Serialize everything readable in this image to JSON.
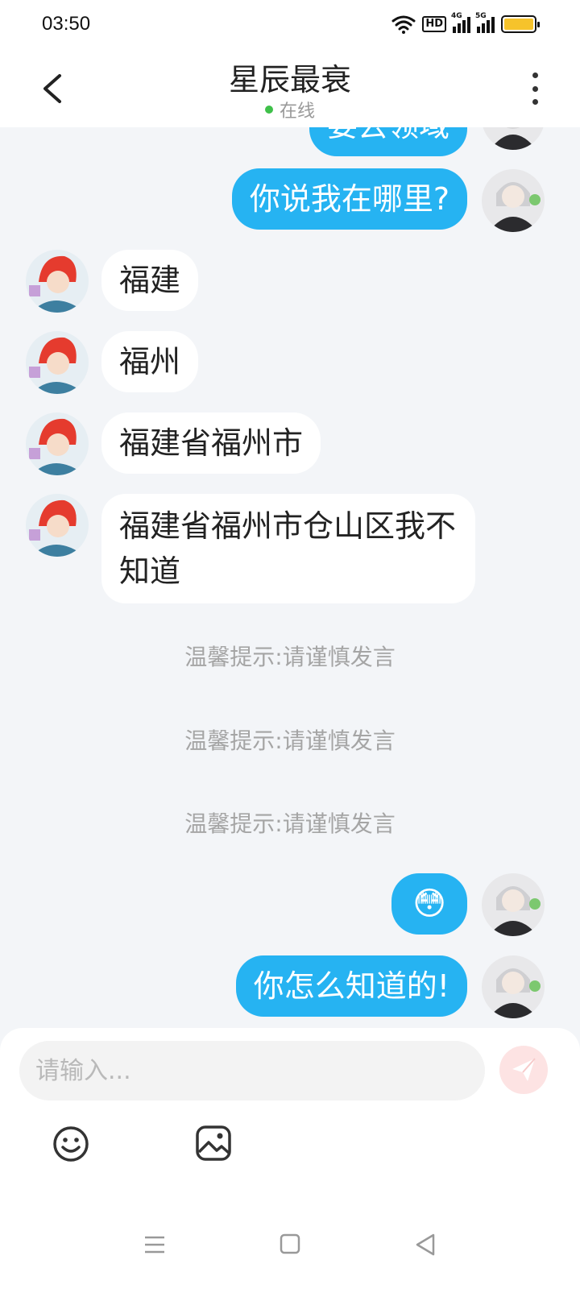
{
  "status_bar": {
    "time": "03:50",
    "signal_1_label": "4G",
    "signal_2_label": "5G",
    "hd_label": "HD",
    "battery_color": "#f6c32b"
  },
  "header": {
    "title": "星辰最衰",
    "status": "在线"
  },
  "messages": [
    {
      "side": "out",
      "text": "要去领域"
    },
    {
      "side": "out",
      "text": "你说我在哪里?"
    },
    {
      "side": "in",
      "text": "福建"
    },
    {
      "side": "in",
      "text": "福州"
    },
    {
      "side": "in",
      "text": "福建省福州市"
    },
    {
      "side": "in",
      "text": "福建省福州市仓山区我不知道"
    },
    {
      "side": "system",
      "text": "温馨提示:请谨慎发言"
    },
    {
      "side": "system",
      "text": "温馨提示:请谨慎发言"
    },
    {
      "side": "system",
      "text": "温馨提示:请谨慎发言"
    },
    {
      "side": "out",
      "text": "😳"
    },
    {
      "side": "out",
      "text": "你怎么知道的!"
    }
  ],
  "composer": {
    "placeholder": "请输入...",
    "send_icon": "send-icon",
    "emoji_icon": "smile-icon",
    "image_icon": "image-icon"
  },
  "colors": {
    "outgoing_bubble": "#26b3f2",
    "incoming_bubble": "#ffffff",
    "online_dot": "#3fc04a"
  }
}
